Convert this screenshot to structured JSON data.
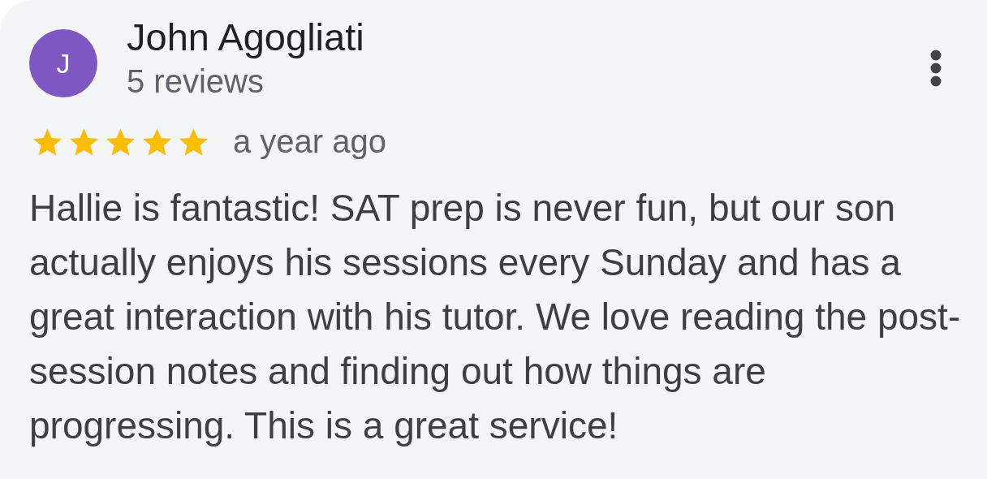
{
  "review": {
    "avatar_initial": "J",
    "author": "John Agogliati",
    "review_count": "5 reviews",
    "stars": 5,
    "time": "a year ago",
    "text": "Hallie is fantastic! SAT prep is never fun, but our son actually enjoys his sessions every Sunday and has a great interaction with his tutor. We love reading the post-session notes and finding out how things are progressing. This is a great service!"
  }
}
